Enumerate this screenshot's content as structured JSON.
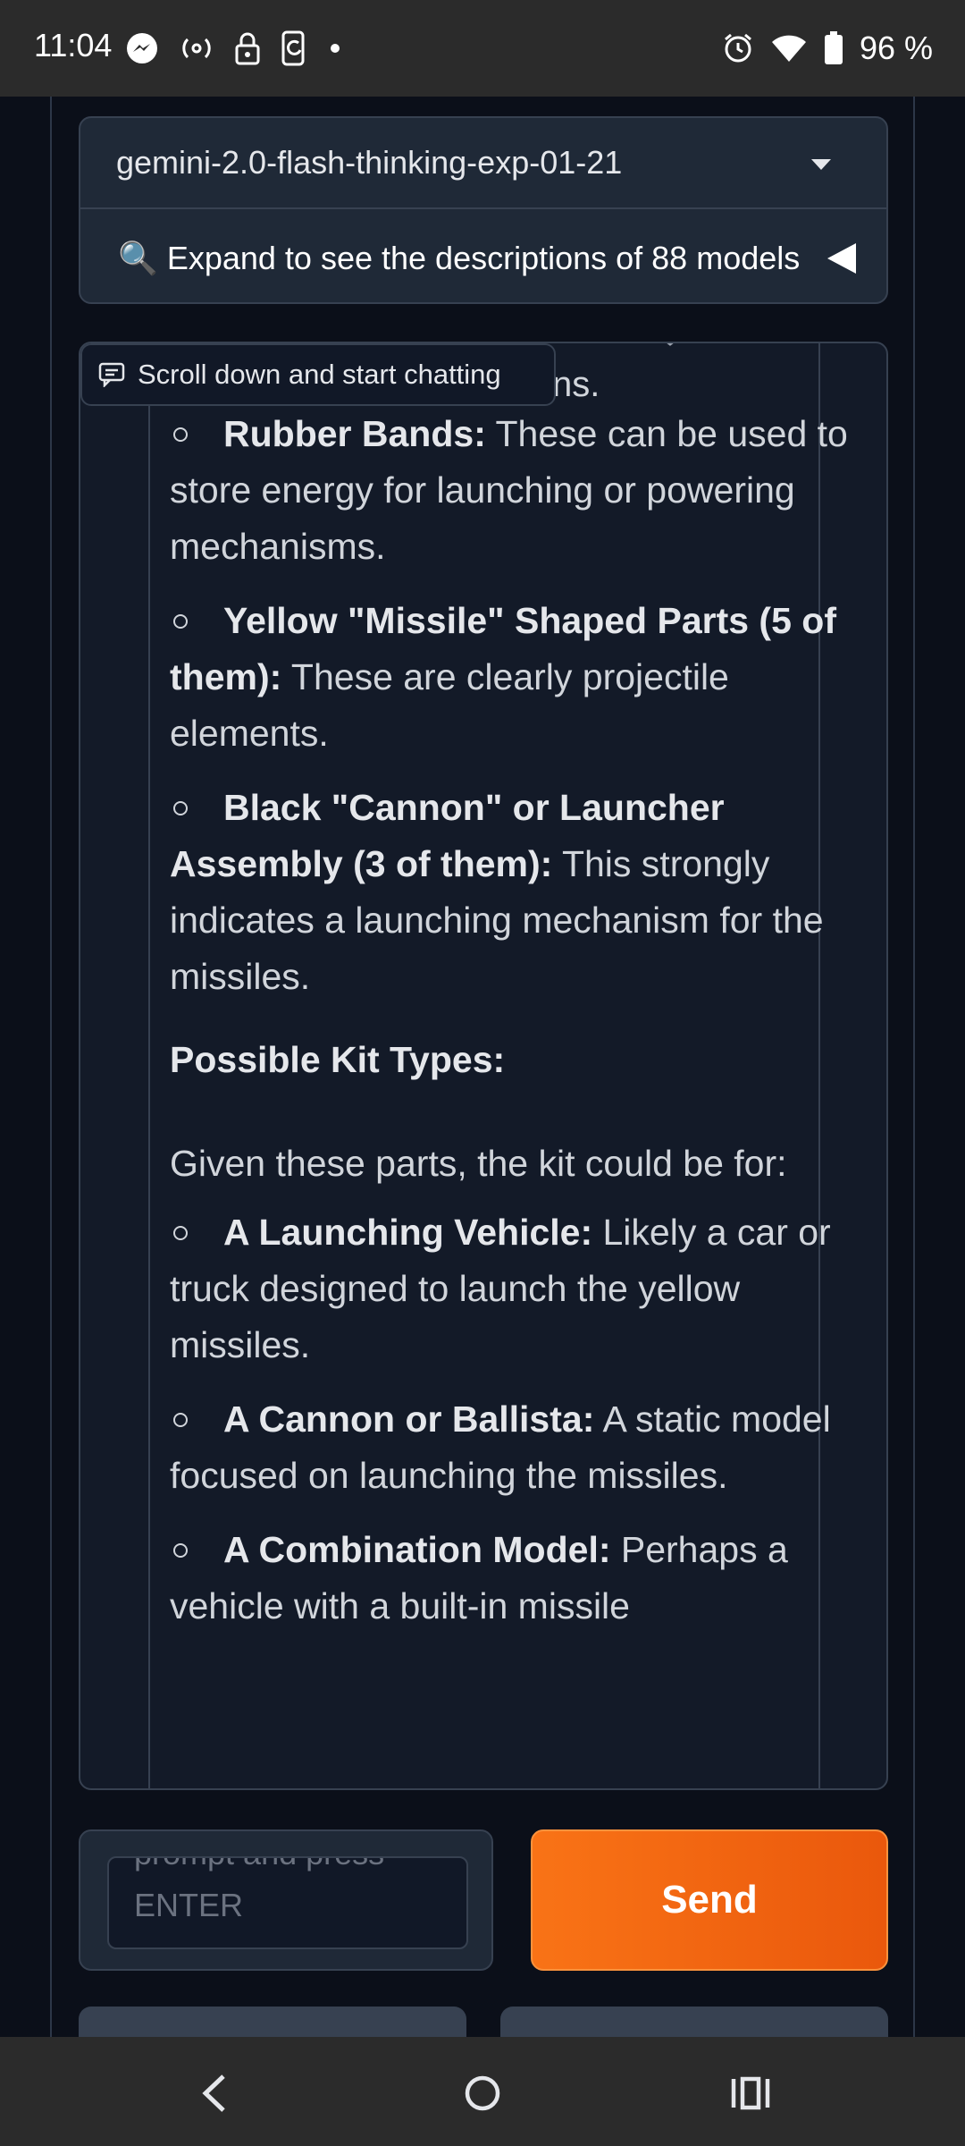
{
  "status_bar": {
    "time": "11:04",
    "battery": "96 %",
    "icons_left": [
      "messenger-icon",
      "hotspot-icon",
      "lock-icon",
      "phone-sync-icon",
      "dot-icon"
    ],
    "icons_right": [
      "alarm-icon",
      "wifi-icon",
      "battery-icon"
    ]
  },
  "model_selector": {
    "selected": "gemini-2.0-flash-thinking-exp-01-21",
    "expand_text": "🔍 Expand to see the descriptions of 88 models"
  },
  "chat": {
    "toast": "Scroll down and start chatting",
    "partial_text": "ns.",
    "items_a": [
      {
        "bold": "Rubber Bands:",
        "text": " These can be used to store energy for launching or powering mechanisms."
      },
      {
        "bold": "Yellow \"Missile\" Shaped Parts (5 of them):",
        "text": " These are clearly projectile elements."
      },
      {
        "bold": "Black \"Cannon\" or Launcher Assembly (3 of them):",
        "text": " This strongly indicates a launching mechanism for the missiles."
      }
    ],
    "heading": "Possible Kit Types:",
    "paragraph": "Given these parts, the kit could be for:",
    "items_b": [
      {
        "bold": "A Launching Vehicle:",
        "text": " Likely a car or truck designed to launch the yellow missiles."
      },
      {
        "bold": "A Cannon or Ballista:",
        "text": " A static model focused on launching the missiles."
      },
      {
        "bold": "A Combination Model:",
        "text": " Perhaps a vehicle with a built-in missile"
      }
    ]
  },
  "input": {
    "placeholder_line1": "prompt and press",
    "placeholder_line2": "ENTER"
  },
  "send_label": "Send",
  "nav_bar": {
    "buttons": [
      "back-icon",
      "home-icon",
      "recents-icon"
    ]
  },
  "colors": {
    "background": "#0b0f19",
    "panel": "#1f2937",
    "accent": "#f97316"
  }
}
